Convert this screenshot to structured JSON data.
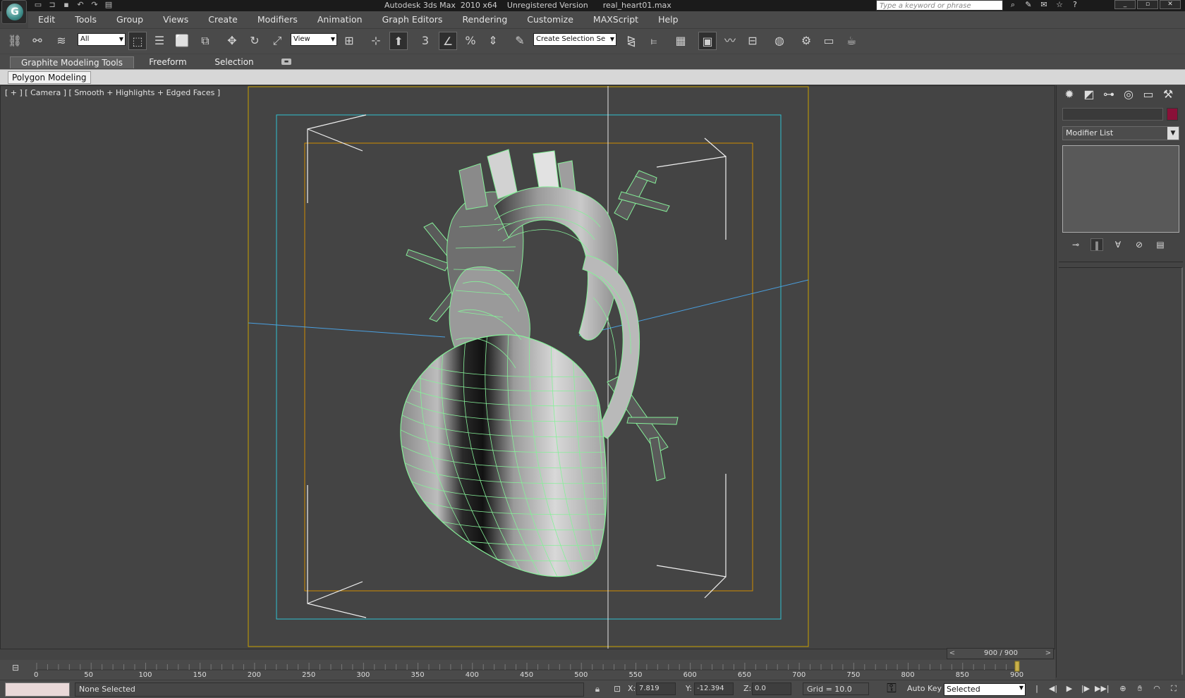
{
  "window": {
    "title": "Autodesk 3ds Max  2010 x64    Unregistered Version      real_heart01.max",
    "search_placeholder": "Type a keyword or phrase",
    "app_logo": "G"
  },
  "quick_access": [
    "new-icon",
    "open-icon",
    "save-icon",
    "undo-icon",
    "redo-icon",
    "project-folder-icon"
  ],
  "menu": [
    "Edit",
    "Tools",
    "Group",
    "Views",
    "Create",
    "Modifiers",
    "Animation",
    "Graph Editors",
    "Rendering",
    "Customize",
    "MAXScript",
    "Help"
  ],
  "toolbar": {
    "selection_filter": "All",
    "reference_coord": "View",
    "named_selection": "Create Selection Se",
    "snap_label": "3"
  },
  "ribbon": {
    "tabs": [
      "Graphite Modeling Tools",
      "Freeform",
      "Selection"
    ],
    "active_tab": 0,
    "panel_label": "Polygon Modeling"
  },
  "viewport": {
    "label": "[ + ] [ Camera ] [ Smooth + Highlights + Edged Faces ]",
    "safe_frame_colors": {
      "outer": "#c8a000",
      "action": "#30c0d0",
      "title": "#d08c00"
    },
    "mesh_wire_color": "#86f099"
  },
  "command_panel": {
    "tabs": [
      "create-icon",
      "modify-icon",
      "hierarchy-icon",
      "motion-icon",
      "display-icon",
      "utilities-icon"
    ],
    "object_name": "",
    "object_color": "#8a1038",
    "modifier_list": "Modifier List",
    "stack_tools": [
      "pin-stack-icon",
      "show-end-result-icon",
      "make-unique-icon",
      "remove-modifier-icon",
      "configure-sets-icon"
    ]
  },
  "time": {
    "slider": "900 / 900",
    "ticks": [
      "0",
      "50",
      "100",
      "150",
      "200",
      "250",
      "300",
      "350",
      "400",
      "450",
      "500",
      "550",
      "600",
      "650",
      "700",
      "750",
      "800",
      "850",
      "900"
    ],
    "current_frame": 900
  },
  "status": {
    "selection_text": "None Selected",
    "x_label": "X:",
    "x_value": "7.819",
    "y_label": "Y:",
    "y_value": "-12.394",
    "z_label": "Z:",
    "z_value": "0.0",
    "grid": "Grid = 10.0",
    "auto_key": "Auto Key",
    "key_mode": "Selected"
  }
}
